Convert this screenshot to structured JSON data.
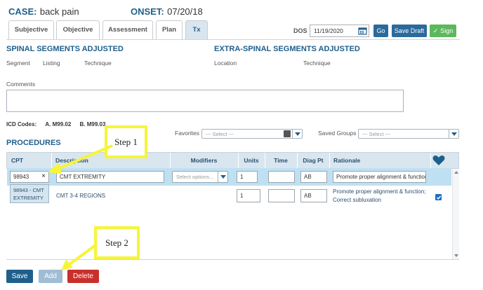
{
  "header": {
    "case_label": "CASE:",
    "case_value": "back pain",
    "onset_label": "ONSET:",
    "onset_value": "07/20/18"
  },
  "tabs": [
    {
      "label": "Subjective",
      "active": false
    },
    {
      "label": "Objective",
      "active": false
    },
    {
      "label": "Assessment",
      "active": false
    },
    {
      "label": "Plan",
      "active": false
    },
    {
      "label": "Tx",
      "active": true
    }
  ],
  "toolbar": {
    "dos_label": "DOS",
    "dos_value": "11/19/2020",
    "go_label": "Go",
    "save_draft_label": "Save Draft",
    "sign_label": "Sign"
  },
  "spinal": {
    "title": "SPINAL SEGMENTS ADJUSTED",
    "col_segment": "Segment",
    "col_listing": "Listing",
    "col_technique": "Technique"
  },
  "extraspinal": {
    "title": "EXTRA-SPINAL SEGMENTS ADJUSTED",
    "col_location": "Location",
    "col_technique": "Technique"
  },
  "comments": {
    "label": "Comments",
    "value": ""
  },
  "icd": {
    "label": "ICD Codes:",
    "code_a": "A. M99.02",
    "code_b": "B. M99.03"
  },
  "favorites": {
    "label": "Favorites",
    "placeholder": "--- Select ---"
  },
  "saved_groups": {
    "label": "Saved Groups",
    "placeholder": "--- Select ---"
  },
  "procedures": {
    "title": "PROCEDURES",
    "columns": {
      "cpt": "CPT",
      "description": "Description",
      "modifiers": "Modifiers",
      "units": "Units",
      "time": "Time",
      "diag_pt": "Diag Pt",
      "rationale": "Rationale"
    },
    "rows": [
      {
        "cpt": "98943",
        "description": "CMT EXTREMITY",
        "modifiers_placeholder": "Select options...",
        "units": "1",
        "time": "",
        "diag": "AB",
        "rationale": "Promote proper alignment & function"
      },
      {
        "cpt": "",
        "description": "CMT 3-4 REGIONS",
        "units": "1",
        "time": "",
        "diag": "AB",
        "rationale_line1": "Promote proper alignment & function;",
        "rationale_line2": "Correct subluxation",
        "checked": true
      }
    ],
    "suggestion": {
      "line1": "98943 - CMT",
      "line2": "EXTREMITY"
    },
    "cpt_clear_glyph": "×"
  },
  "callouts": {
    "step1": "Step 1",
    "step2": "Step 2"
  },
  "footer": {
    "save_label": "Save",
    "add_label": "Add",
    "delete_label": "Delete"
  },
  "colors": {
    "brand_blue": "#1f5f8b",
    "sign_green": "#5cb85c",
    "delete_red": "#c9302c",
    "callout_yellow": "#f5f53a"
  }
}
